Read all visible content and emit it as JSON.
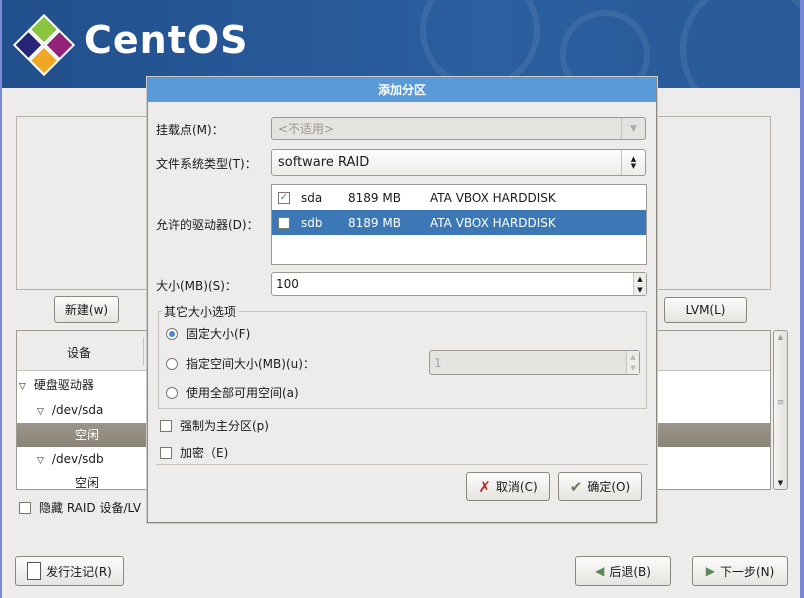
{
  "banner": {
    "logo_text": "CentOS"
  },
  "background": {
    "new_button": "新建(w)",
    "lvm_button": "LVM(L)",
    "tree": {
      "column_header": "设备",
      "rows": [
        {
          "label": "硬盘驱动器",
          "level": 0,
          "expanded": true,
          "selected": false
        },
        {
          "label": "/dev/sda",
          "level": 1,
          "expanded": true,
          "selected": false
        },
        {
          "label": "空闲",
          "level": 2,
          "selected": true
        },
        {
          "label": "/dev/sdb",
          "level": 1,
          "expanded": true,
          "selected": false
        },
        {
          "label": "空闲",
          "level": 2,
          "selected": false
        }
      ]
    },
    "hide_raid_checkbox": "隐藏 RAID 设备/LV",
    "release_notes_button": "发行注记(R)",
    "back_button": "后退(B)",
    "next_button": "下一步(N)"
  },
  "dialog": {
    "title": "添加分区",
    "mount_point": {
      "label": "挂载点(M)：",
      "value": "<不适用>"
    },
    "fs_type": {
      "label": "文件系统类型(T)：",
      "value": "software RAID"
    },
    "drives": {
      "label": "允许的驱动器(D)：",
      "rows": [
        {
          "checked": true,
          "name": "sda",
          "size": "8189 MB",
          "model": "ATA VBOX HARDDISK"
        },
        {
          "checked": false,
          "name": "sdb",
          "size": "8189 MB",
          "model": "ATA VBOX HARDDISK"
        }
      ]
    },
    "size": {
      "label": "大小(MB)(S)：",
      "value": "100"
    },
    "other_size": {
      "title": "其它大小选项",
      "fixed": "固定大小(F)",
      "fill_to": "指定空间大小(MB)(u)：",
      "fill_to_value": "1",
      "fill_all": "使用全部可用空间(a)",
      "selected": "fixed"
    },
    "force_primary": "强制为主分区(p)",
    "encrypt": "加密（E)",
    "cancel": "取消(C)",
    "ok": "确定(O)",
    "accent": "#5a9ad8"
  }
}
